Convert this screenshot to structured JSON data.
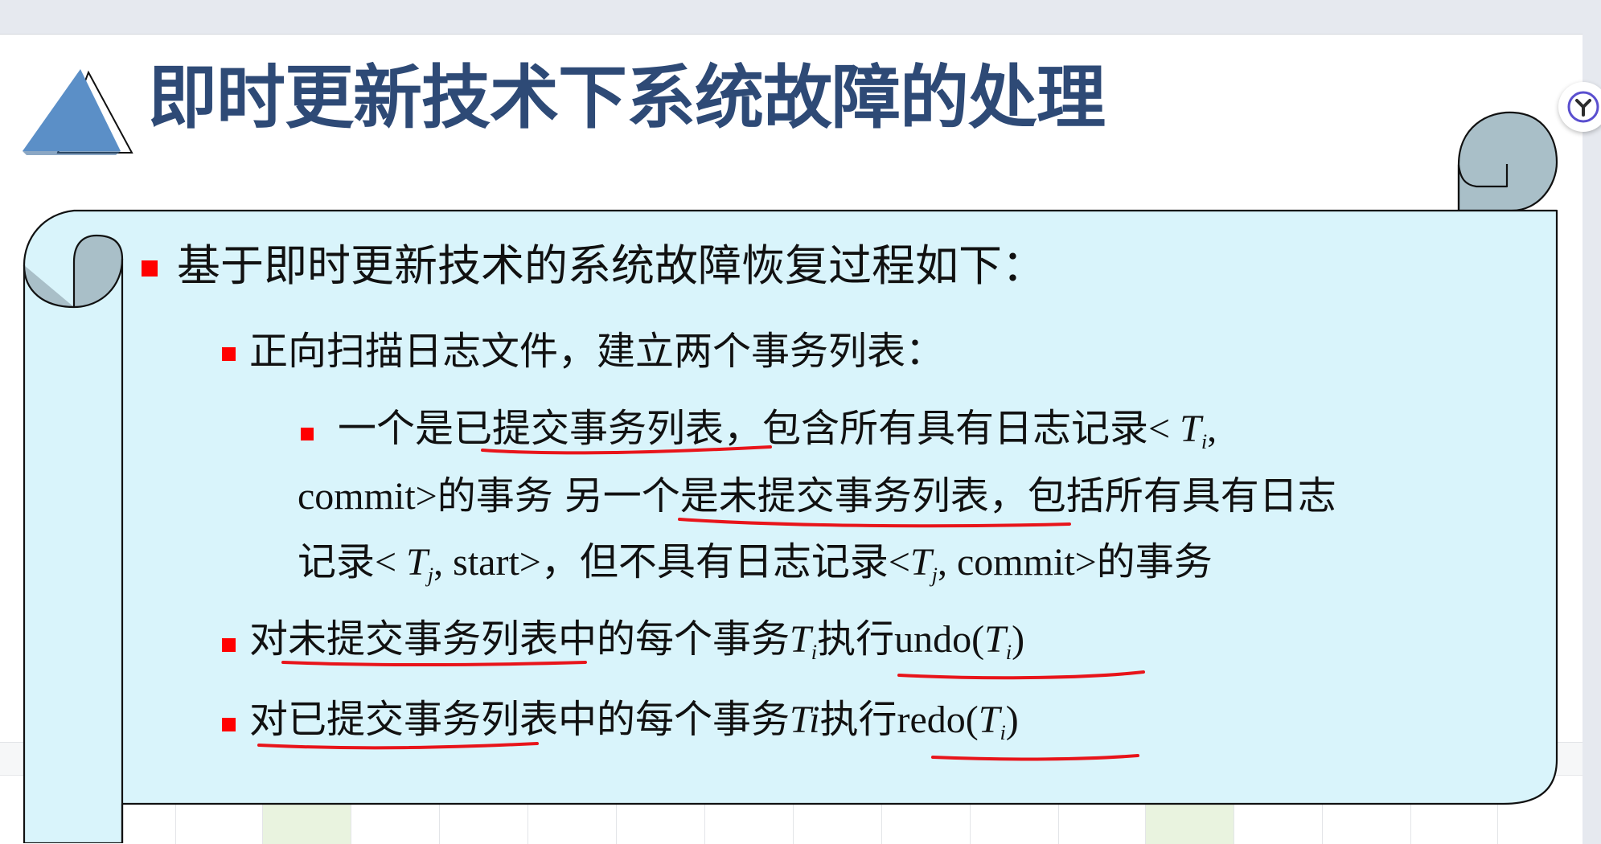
{
  "slide": {
    "title": "即时更新技术下系统故障的处理",
    "items": [
      {
        "level": 1,
        "text": "基于即时更新技术的系统故障恢复过程如下："
      },
      {
        "level": 2,
        "text": "正向扫描日志文件，建立两个事务列表："
      },
      {
        "level": 3,
        "line1": {
          "a": "一个是",
          "b": "已提交事务列表",
          "c": "，包含所有具有日志记录",
          "d": "< ",
          "e": "T",
          "f": "i",
          "g": ","
        },
        "line2": {
          "a": "commit>",
          "b": "的事务",
          "c": "另一个是",
          "d": "未提交事务列表",
          "e": "，包括所有具有日志"
        },
        "line3": {
          "a": "记录",
          "b": "< ",
          "c": "T",
          "d": "j",
          "e": ", start>",
          "f": "，但不具有日志记录",
          "g": "<",
          "h": "T",
          "i": "j",
          "j": ", commit>",
          "k": "的事务"
        }
      },
      {
        "level": 2,
        "a": "对",
        "b": "未提交事务列表",
        "c": "中的每个事务",
        "d": "T",
        "e": "i",
        "f": "执行",
        "g": "undo(",
        "h": "T",
        "i": "i",
        "j": ")"
      },
      {
        "level": 2,
        "a": "对",
        "b": "已提交事务列表",
        "c": "中的每个事务",
        "d": "Ti",
        "e": "执行",
        "f": "redo(",
        "g": "T",
        "h": "i",
        "i": ")"
      }
    ]
  },
  "colors": {
    "title": "#2e4a76",
    "scroll_fill": "#d9f4fb",
    "scroll_curl": "#a9bfc8",
    "bullet": "#ff0000",
    "annotation": "#e8141a",
    "triangle": "#5b8fc7"
  },
  "icons": {
    "extension": "extension-icon"
  }
}
